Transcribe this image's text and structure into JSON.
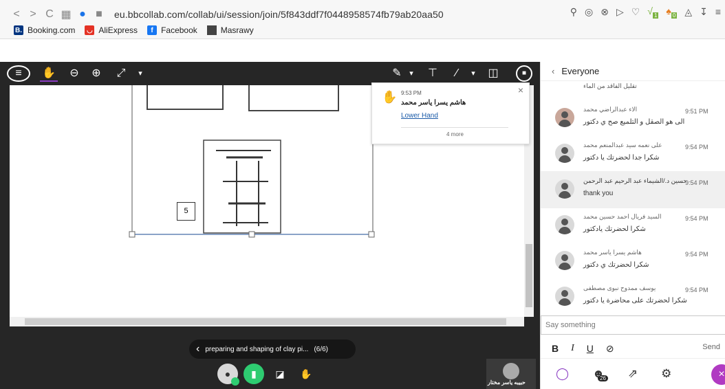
{
  "browser": {
    "url": "eu.bbcollab.com/collab/ui/session/join/5f843ddf7f0448958574fb79ab20aa50",
    "bookmarks": [
      {
        "label": "Booking.com",
        "icon": "B.",
        "color": "#003580"
      },
      {
        "label": "AliExpress",
        "icon": "",
        "color": "#e43225"
      },
      {
        "label": "Facebook",
        "icon": "f",
        "color": "#1877f2"
      },
      {
        "label": "Masrawy",
        "icon": "",
        "color": "#444444"
      }
    ],
    "badges": {
      "first": "1",
      "second": "0"
    }
  },
  "whiteboard": {
    "page_number": "5",
    "notification": {
      "time": "9:53 PM",
      "name": "هاشم يسرا ياسر محمد",
      "action": "Lower Hand",
      "more": "4 more"
    },
    "file_title": "preparing and shaping of clay pi...",
    "file_page": "(6/6)",
    "self_name": "حبيبه ياسر مختار"
  },
  "chat": {
    "header": "Everyone",
    "top_text": "تقليل الفاقد من الماء",
    "messages": [
      {
        "name": "الاء عبدالراضي محمد",
        "text": "الى هو الصقل و التلميع صح ي دكتور",
        "time": "9:51 PM",
        "photo": true
      },
      {
        "name": "على نعمه سيد عبدالمنعم محمد",
        "text": "شكرا جدا لحضرتك يا دكتور",
        "time": "9:54 PM"
      },
      {
        "name": "حسين د./الشيماء عبد الرحيم عبد الرحمن",
        "text": "thank you",
        "time": "9:54 PM",
        "highlight": true
      },
      {
        "name": "السيد فريال احمد حسين محمد",
        "text": "شكرا لحضرتك يادكتور",
        "time": "9:54 PM"
      },
      {
        "name": "هاشم يسرا ياسر محمد",
        "text": "شكرا لحضرتك ي دكتور",
        "time": "9:54 PM"
      },
      {
        "name": "يوسف ممدوح نبوى مصطفى",
        "text": "شكرا لحضرتك على محاضرة يا دكتور",
        "time": "9:54 PM"
      }
    ],
    "input_placeholder": "Say something",
    "send_label": "Send",
    "participants_count": "26"
  },
  "colors": {
    "stage": "#262626",
    "accent": "#8a3cc2",
    "link": "#1a5aa8"
  }
}
